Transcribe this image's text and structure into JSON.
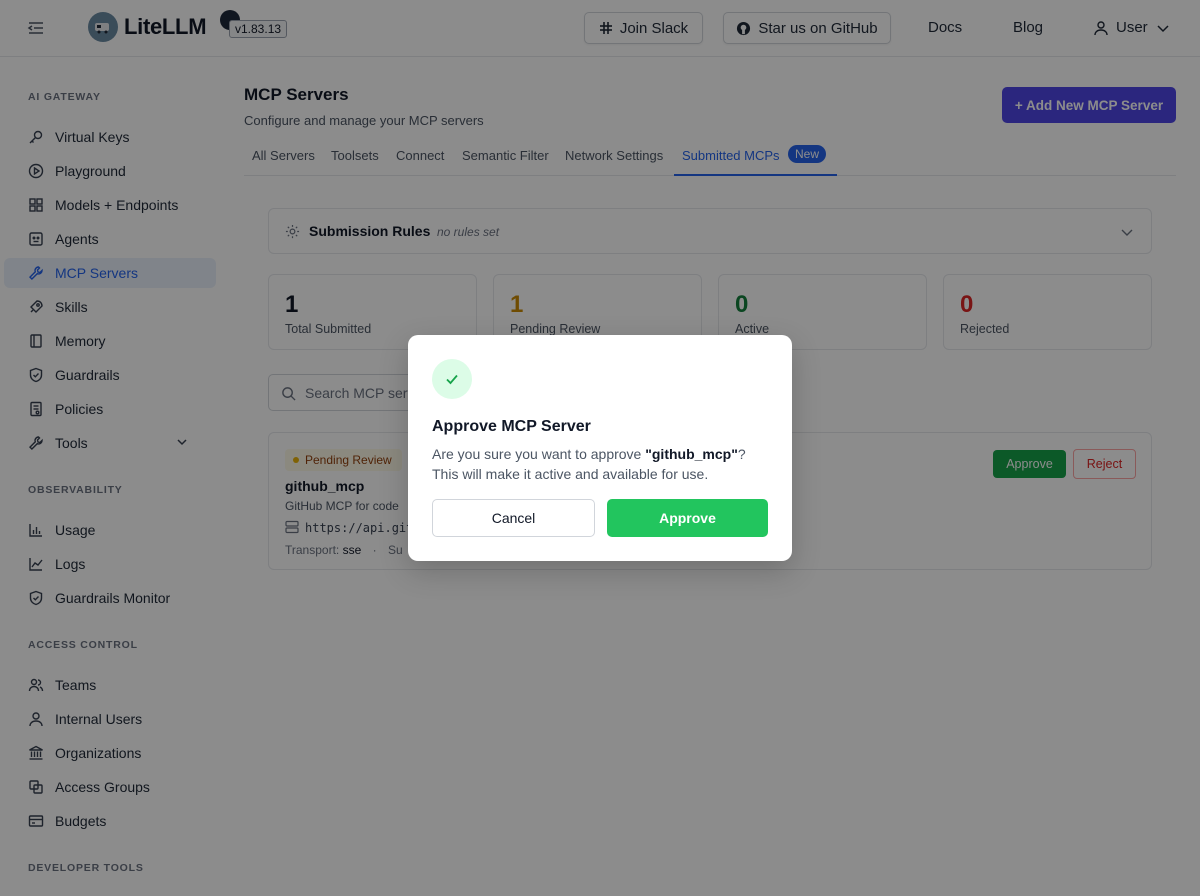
{
  "header": {
    "logo_text": "LiteLLM",
    "version": "v1.83.13",
    "join_slack": "Join Slack",
    "star_github": "Star us on GitHub",
    "docs": "Docs",
    "blog": "Blog",
    "user": "User"
  },
  "sidebar": {
    "sections": [
      {
        "title": "AI GATEWAY",
        "items": [
          "Virtual Keys",
          "Playground",
          "Models + Endpoints",
          "Agents",
          "MCP Servers",
          "Skills",
          "Memory",
          "Guardrails",
          "Policies",
          "Tools"
        ]
      },
      {
        "title": "OBSERVABILITY",
        "items": [
          "Usage",
          "Logs",
          "Guardrails Monitor"
        ]
      },
      {
        "title": "ACCESS CONTROL",
        "items": [
          "Teams",
          "Internal Users",
          "Organizations",
          "Access Groups",
          "Budgets"
        ]
      },
      {
        "title": "DEVELOPER TOOLS",
        "items": []
      }
    ],
    "active_item": "MCP Servers"
  },
  "main": {
    "title": "MCP Servers",
    "subtitle": "Configure and manage your MCP servers",
    "add_button": "+ Add New MCP Server",
    "tabs": [
      "All Servers",
      "Toolsets",
      "Connect",
      "Semantic Filter",
      "Network Settings",
      "Submitted MCPs"
    ],
    "tab_badge": "New",
    "active_tab": "Submitted MCPs",
    "rules": {
      "title": "Submission Rules",
      "note": "no rules set"
    },
    "stats": [
      {
        "value": "1",
        "label": "Total Submitted",
        "color": "#111827"
      },
      {
        "value": "1",
        "label": "Pending Review",
        "color": "#ca8a04"
      },
      {
        "value": "0",
        "label": "Active",
        "color": "#15803d"
      },
      {
        "value": "0",
        "label": "Rejected",
        "color": "#dc2626"
      }
    ],
    "search_placeholder": "Search MCP servers...",
    "card": {
      "status": "Pending Review",
      "name": "github_mcp",
      "description": "GitHub MCP for code",
      "url": "https://api.github.com/mcp",
      "transport_label": "Transport:",
      "transport_value": "sse",
      "submitted_fragment": "Su",
      "approve": "Approve",
      "reject": "Reject"
    }
  },
  "modal": {
    "title": "Approve MCP Server",
    "text_prefix": "Are you sure you want to approve ",
    "server_name": "\"github_mcp\"",
    "text_suffix": "? This will make it active and available for use.",
    "cancel": "Cancel",
    "approve": "Approve"
  }
}
